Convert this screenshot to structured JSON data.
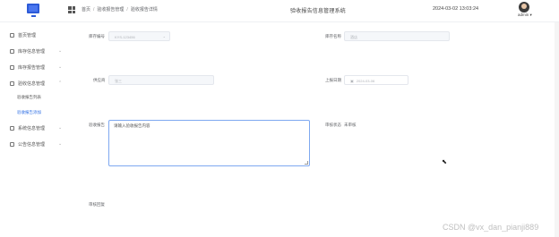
{
  "header": {
    "breadcrumb": [
      "首页",
      "验收报告管理",
      "验收报告详情"
    ],
    "app_title": "验收报告信息管理系统",
    "datetime": "2024-03-02 13:03:24",
    "user": "admin"
  },
  "sidebar": {
    "items": [
      {
        "label": "首页管理"
      },
      {
        "label": "库存信息管理"
      },
      {
        "label": "库存报告管理"
      },
      {
        "label": "验收信息管理"
      },
      {
        "label": "系统信息管理"
      },
      {
        "label": "公告信息管理"
      }
    ],
    "sub_items": [
      {
        "label": "验收报告列表"
      },
      {
        "label": "验收报告添加"
      }
    ]
  },
  "form": {
    "field1_label": "库存编号",
    "field1_value": "KYS-123456",
    "field2_label": "库存名称",
    "field2_value": "酒店",
    "field3_label": "供应商",
    "field3_value": "张三",
    "field4_label": "上报日期",
    "field4_value": "2024-03-06",
    "report_label": "验收报告",
    "report_value": "请输入验收报告内容",
    "status_label": "审核状态",
    "status_value": "未审核",
    "reply_label": "审核回复"
  },
  "watermark": "CSDN @vx_dan_pianji889"
}
